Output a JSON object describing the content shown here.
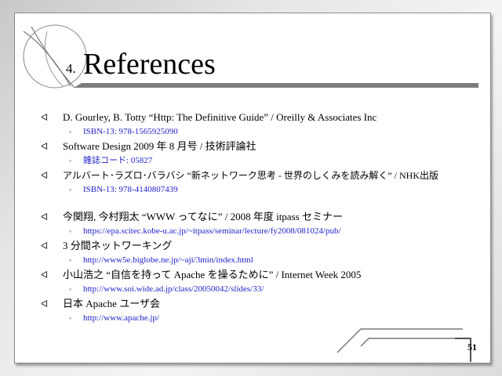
{
  "slide": {
    "title_number": "4.",
    "title": "References",
    "page_number": "51"
  },
  "references": [
    {
      "text": "D. Gourley, B. Totty “Http: The Definitive Guide” / Oreilly & Associates Inc",
      "sub": "ISBN-13: 978-1565925090"
    },
    {
      "text": "Software Design 2009 年 8 月号 / 技術評論社",
      "sub": "雑誌コード: 05827"
    },
    {
      "text": "アルバート･ラズロ･バラバシ “新ネットワーク思考 - 世界のしくみを読み解く” / NHK出版",
      "sub": "ISBN-13: 978-4140807439"
    },
    {
      "text": "今関翔, 今村翔太 “WWW ってなに” / 2008 年度 itpass セミナー",
      "sub": "https://epa.scitec.kobe-u.ac.jp/~itpass/seminar/lecture/fy2008/081024/pub/"
    },
    {
      "text": "3 分間ネットワーキング",
      "sub": "http://www5e.biglobe.ne.jp/~aji/3min/index.html"
    },
    {
      "text": "小山浩之 “自信を持って Apache を操るために” / Internet Week 2005",
      "sub": "http://www.soi.wide.ad.jp/class/20050042/slides/33/"
    },
    {
      "text": "日本 Apache ユーザ会",
      "sub": "http://www.apache.jp/"
    }
  ],
  "icons": {
    "level1_bullet": "arrow-bullet-icon",
    "level2_bullet": "small-bullet-icon"
  },
  "colors": {
    "link": "#1e1ec8",
    "text": "#000000"
  }
}
